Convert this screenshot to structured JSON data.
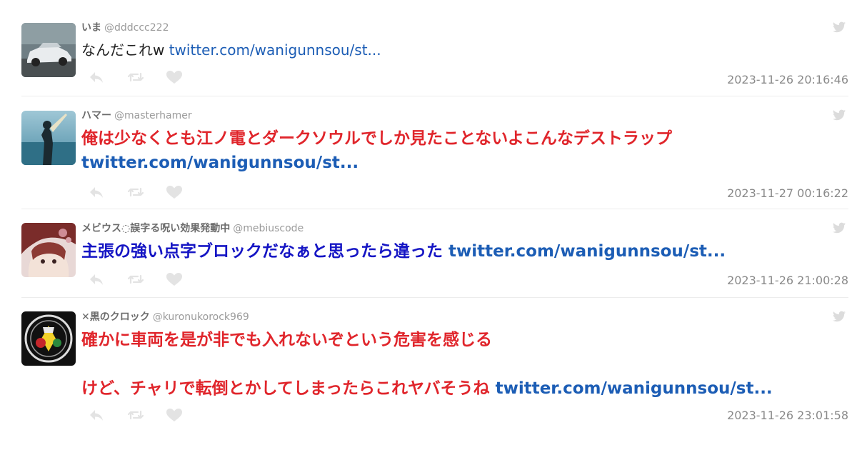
{
  "tweets": [
    {
      "avatar_icon": "car-avatar-icon",
      "display_name": "いま",
      "handle": "@dddccc222",
      "text": "なんだこれw",
      "link": "twitter.com/wanigunnsou/st...",
      "timestamp": "2023-11-26 20:16:46"
    },
    {
      "avatar_icon": "surfer-avatar-icon",
      "display_name": "ハマー",
      "handle": "@masterhamer",
      "text": "俺は少なくとも江ノ電とダークソウルでしか見たことないよこんなデストラップ",
      "link": "twitter.com/wanigunnsou/st...",
      "timestamp": "2023-11-27 00:16:22",
      "text_color": "#e0252b"
    },
    {
      "avatar_icon": "anime-avatar-icon",
      "display_name": "メビウス◌誤字る呪い効果発動中",
      "handle": "@mebiuscode",
      "text": "主張の強い点字ブロックだなぁと思ったら違った",
      "link": "twitter.com/wanigunnsou/st...",
      "timestamp": "2023-11-26 21:00:28",
      "text_color": "#1515c4"
    },
    {
      "avatar_icon": "emblem-avatar-icon",
      "display_name": "✕黒のクロック",
      "handle": "@kuronukorock969",
      "text_line1": "確かに車両を是が非でも入れないぞという危害を感じる",
      "text_line2": "けど、チャリで転倒とかしてしまったらこれヤバそうね",
      "link": "twitter.com/wanigunnsou/st...",
      "timestamp": "2023-11-26 23:01:58",
      "text_color": "#e0252b"
    }
  ],
  "icons": {
    "bird": "twitter-bird-icon",
    "reply": "reply-icon",
    "retweet": "retweet-icon",
    "like": "heart-icon"
  },
  "colors": {
    "red_text": "#e0252b",
    "blue_text": "#1515c4",
    "link": "#1c5db5",
    "muted": "#8a8a8a"
  }
}
